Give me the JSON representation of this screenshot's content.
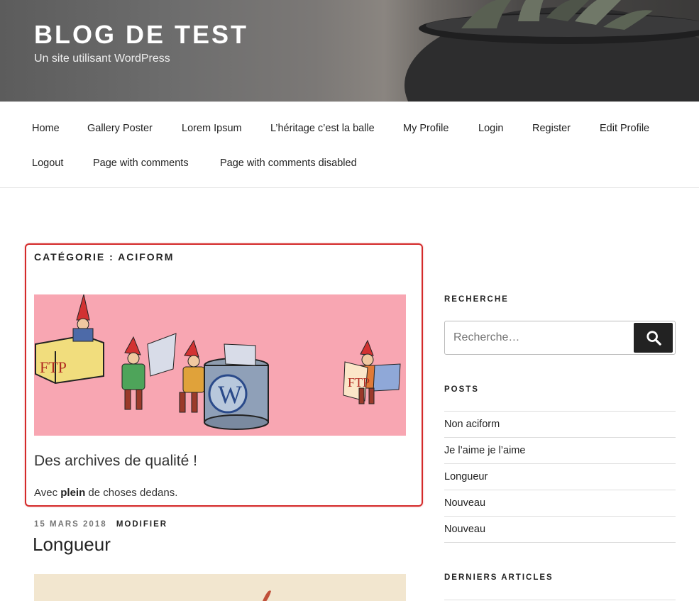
{
  "header": {
    "title": "BLOG DE TEST",
    "tagline": "Un site utilisant WordPress"
  },
  "nav": {
    "items": [
      "Home",
      "Gallery Poster",
      "Lorem Ipsum",
      "L’héritage c’est la balle",
      "My Profile",
      "Login",
      "Register",
      "Edit Profile",
      "Logout",
      "Page with comments",
      "Page with comments disabled"
    ]
  },
  "archive": {
    "title": "CATÉGORIE : ACIFORM",
    "heading": "Des archives de qualité !",
    "desc_prefix": "Avec ",
    "desc_bold": "plein",
    "desc_suffix": " de choses dedans.",
    "image_labels": {
      "box": "FTP",
      "bin": "W",
      "card": "FTP"
    }
  },
  "post": {
    "date": "15 MARS 2018",
    "edit": "MODIFIER",
    "title": "Longueur"
  },
  "sidebar": {
    "search_title": "RECHERCHE",
    "search_placeholder": "Recherche…",
    "posts_title": "POSTS",
    "posts": [
      "Non aciform",
      "Je l’aime je l’aime",
      "Longueur",
      "Nouveau",
      "Nouveau"
    ],
    "recent_title": "DERNIERS ARTICLES"
  },
  "colors": {
    "highlight_border": "#d42a2a",
    "image_bg": "#f8a6b2"
  },
  "icons": {
    "search": "search-icon"
  }
}
